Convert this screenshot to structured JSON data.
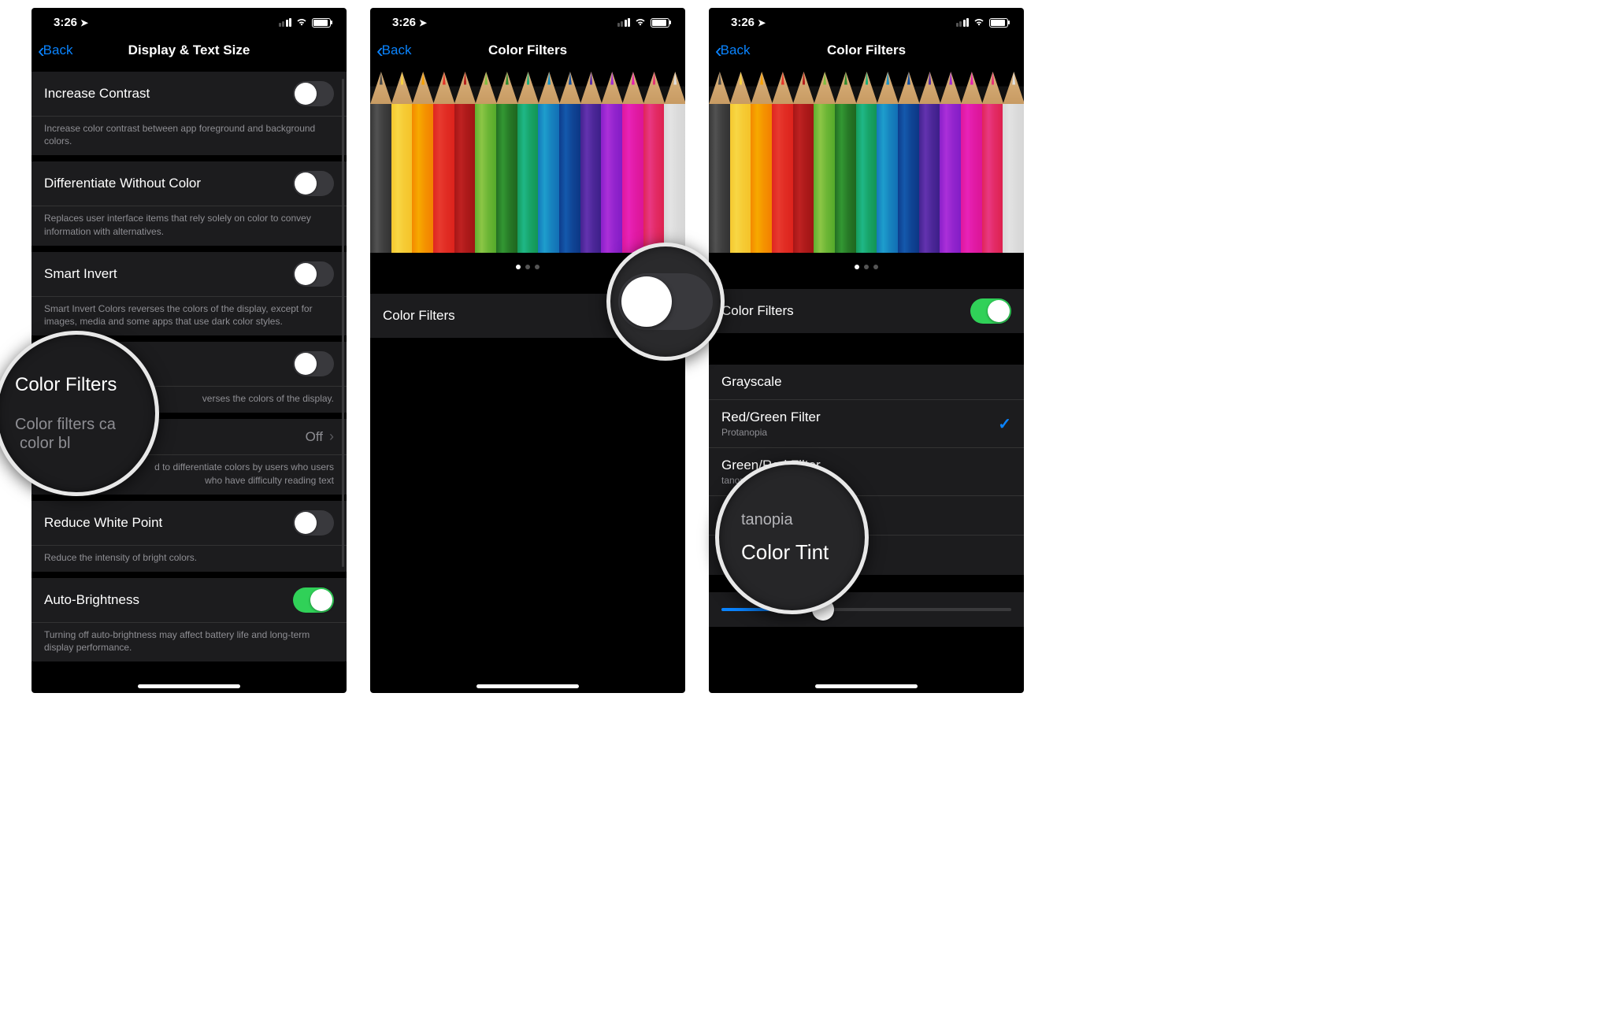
{
  "status": {
    "time": "3:26",
    "location_glyph": "➤"
  },
  "nav": {
    "back": "Back"
  },
  "screen1": {
    "title": "Display & Text Size",
    "rows": {
      "increase_contrast": "Increase Contrast",
      "increase_contrast_footer": "Increase color contrast between app foreground and background colors.",
      "diff_without_color": "Differentiate Without Color",
      "diff_without_color_footer": "Replaces user interface items that rely solely on color to convey information with alternatives.",
      "smart_invert": "Smart Invert",
      "smart_invert_footer": "Smart Invert Colors reverses the colors of the display, except for images, media and some apps that use dark color styles.",
      "classic_invert_footer_partial": "verses the colors of the display.",
      "color_filters": "Color Filters",
      "color_filters_value": "Off",
      "color_filters_footer_partial": "d to differentiate colors by users who users who have difficulty reading text",
      "reduce_white_point": "Reduce White Point",
      "reduce_white_point_footer": "Reduce the intensity of bright colors.",
      "auto_brightness": "Auto-Brightness",
      "auto_brightness_footer": "Turning off auto-brightness may affect battery life and long-term display performance."
    }
  },
  "screen2": {
    "title": "Color Filters",
    "toggle_label": "Color Filters"
  },
  "screen3": {
    "title": "Color Filters",
    "toggle_label": "Color Filters",
    "options": {
      "grayscale": "Grayscale",
      "redgreen": "Red/Green Filter",
      "redgreen_sub": "Protanopia",
      "greenred": "Green/Red Filter",
      "greenred_sub_partial": "tanopia"
    },
    "slider_value_pct": 35
  },
  "magnifiers": {
    "a_line1": "Color Filters",
    "a_line2": "Color filters ca",
    "a_line3": "color bl",
    "c_sub": "tanopia",
    "c_line": "Color Tint"
  },
  "pencil_colors": [
    "#4a4a4a",
    "#f7d23e",
    "#f6a000",
    "#e5342a",
    "#b71e1e",
    "#7fbf3f",
    "#2e8b2e",
    "#1caf7a",
    "#1b93c7",
    "#1251a3",
    "#5a2ea6",
    "#a12bd4",
    "#e51fb0",
    "#e63276",
    "#e0e0e0"
  ]
}
